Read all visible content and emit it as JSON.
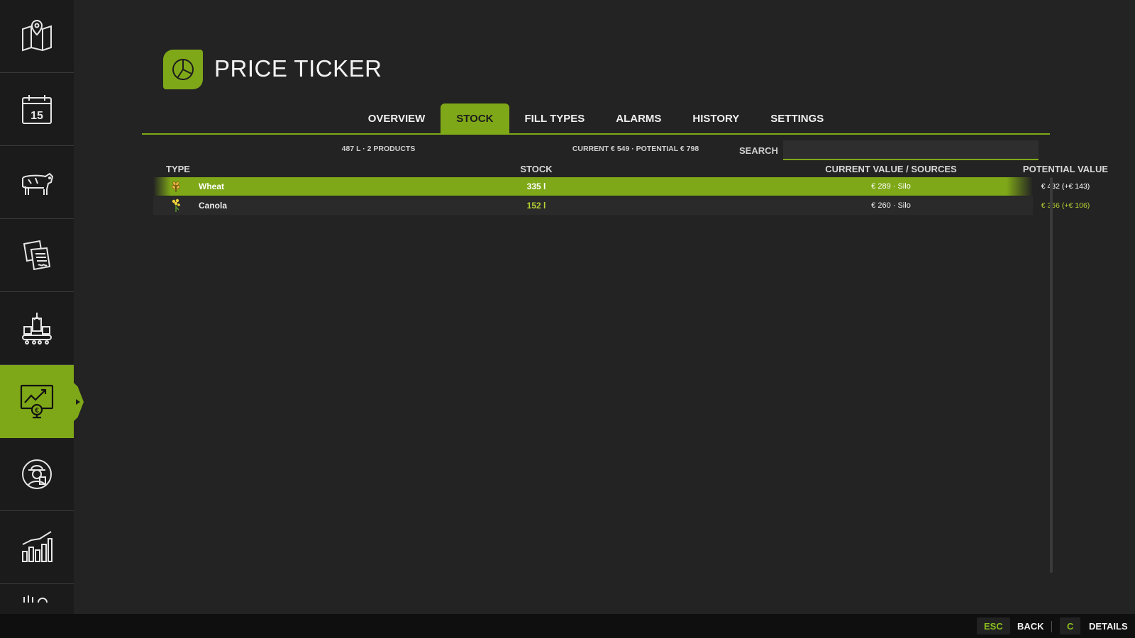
{
  "app": {
    "title": "PRICE TICKER",
    "logo_icon": "pie-chart-icon",
    "accent_color": "#7fa818"
  },
  "sidebar": {
    "items": [
      {
        "name": "map",
        "icon": "map-pin-icon",
        "active": false
      },
      {
        "name": "calendar",
        "icon": "calendar-icon",
        "label": "15",
        "active": false
      },
      {
        "name": "animals",
        "icon": "cow-icon",
        "active": false
      },
      {
        "name": "contracts",
        "icon": "documents-icon",
        "active": false
      },
      {
        "name": "production",
        "icon": "factory-icon",
        "active": false
      },
      {
        "name": "price-ticker",
        "icon": "monitor-chart-euro-icon",
        "active": true
      },
      {
        "name": "workers",
        "icon": "farmer-icon",
        "active": false
      },
      {
        "name": "statistics",
        "icon": "bar-chart-icon",
        "active": false
      },
      {
        "name": "more",
        "icon": "partial-icon",
        "active": false
      }
    ]
  },
  "tabs": [
    {
      "label": "OVERVIEW",
      "active": false
    },
    {
      "label": "STOCK",
      "active": true
    },
    {
      "label": "FILL TYPES",
      "active": false
    },
    {
      "label": "ALARMS",
      "active": false
    },
    {
      "label": "HISTORY",
      "active": false
    },
    {
      "label": "SETTINGS",
      "active": false
    }
  ],
  "summary": {
    "stock_text": "487 L · 2 PRODUCTS",
    "value_text": "CURRENT € 549 · POTENTIAL € 798"
  },
  "search": {
    "label": "SEARCH",
    "value": "",
    "placeholder": ""
  },
  "table": {
    "headers": {
      "type": "TYPE",
      "stock": "STOCK",
      "current": "CURRENT VALUE / SOURCES",
      "potential": "POTENTIAL VALUE"
    },
    "rows": [
      {
        "icon": "wheat-icon",
        "name": "Wheat",
        "stock": "335 l",
        "current": "€ 289 · Silo",
        "potential": "€ 432 (+€ 143)",
        "selected": true
      },
      {
        "icon": "canola-icon",
        "name": "Canola",
        "stock": "152 l",
        "current": "€ 260 · Silo",
        "potential": "€ 366 (+€ 106)",
        "selected": false
      }
    ]
  },
  "footer": {
    "actions": [
      {
        "key": "ESC",
        "label": "BACK"
      },
      {
        "key": "C",
        "label": "DETAILS"
      }
    ]
  }
}
